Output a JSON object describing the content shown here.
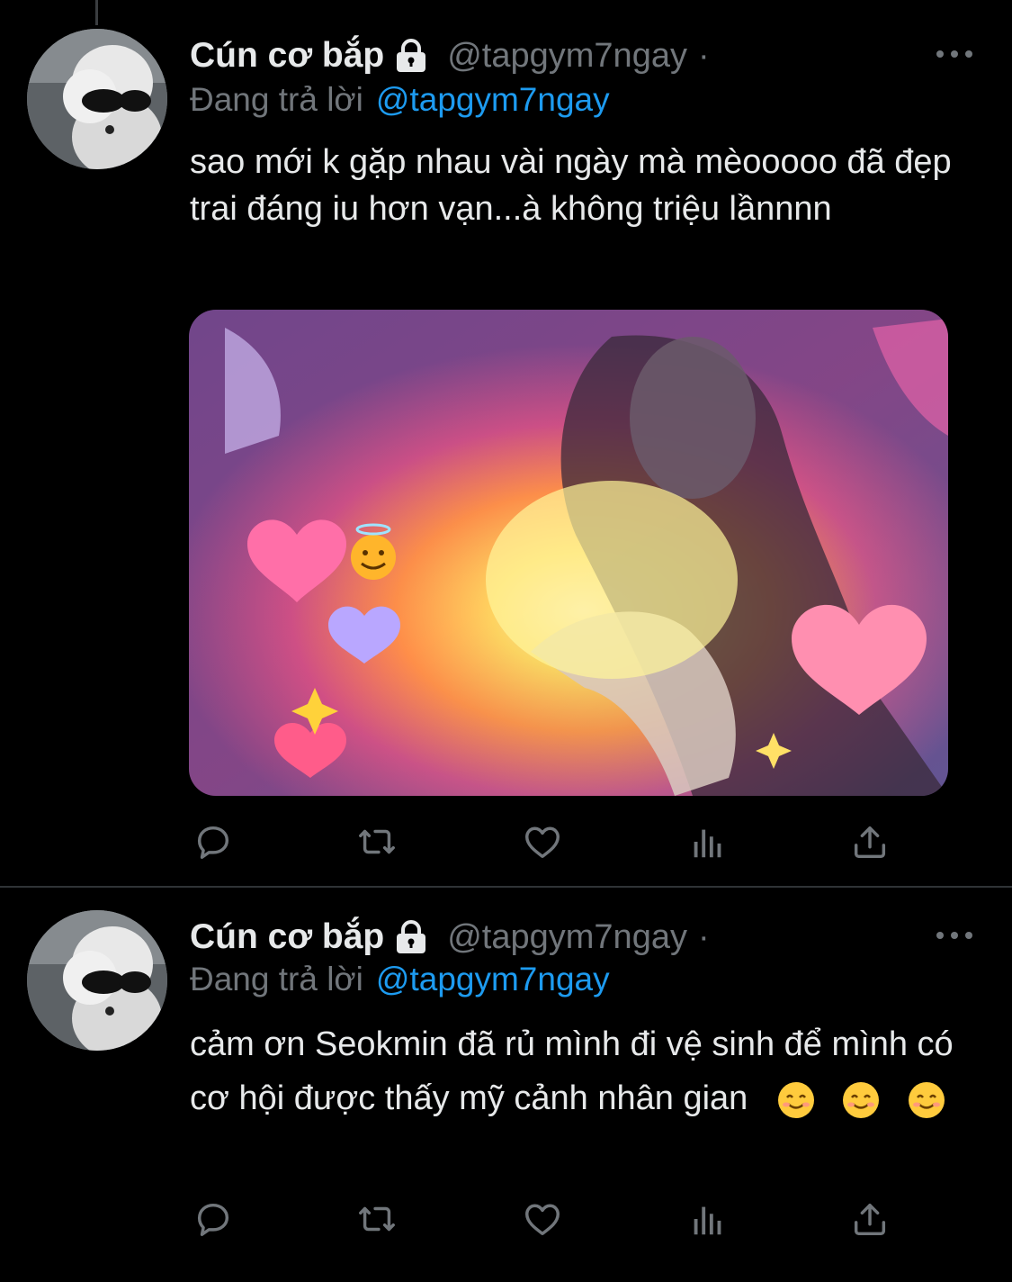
{
  "colors": {
    "background": "#000000",
    "primary_text": "#e7e9ea",
    "secondary_text": "#71767b",
    "accent": "#1d9bf0",
    "divider": "#2f3336"
  },
  "tweets": [
    {
      "author_name": "Cún cơ bắp",
      "protected_icon": "lock-icon",
      "handle": "@tapgym7ngay",
      "separator": "·",
      "reply_prefix": "Đang trả lời",
      "reply_to": "@tapgym7ngay",
      "text": "sao mới k gặp nhau vài ngày mà mèooooo đã đẹp trai đáng iu hơn vạn...à không triệu lầnnnn",
      "has_media": true,
      "actions": [
        "reply-icon",
        "retweet-icon",
        "like-icon",
        "views-icon",
        "share-icon"
      ]
    },
    {
      "author_name": "Cún cơ bắp",
      "protected_icon": "lock-icon",
      "handle": "@tapgym7ngay",
      "separator": "·",
      "reply_prefix": "Đang trả lời",
      "reply_to": "@tapgym7ngay",
      "text": "cảm ơn Seokmin đã rủ mình đi vệ sinh để mình có cơ hội được thấy mỹ cảnh nhân gian",
      "emojis": [
        "😊",
        "😊",
        "😊"
      ],
      "has_media": false,
      "actions": [
        "reply-icon",
        "retweet-icon",
        "like-icon",
        "views-icon",
        "share-icon"
      ]
    }
  ]
}
